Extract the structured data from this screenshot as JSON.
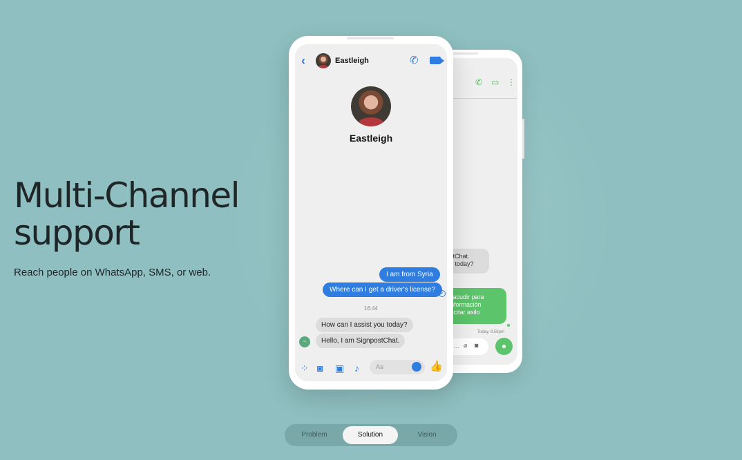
{
  "hero": {
    "title": "Multi-Channel support",
    "subtitle": "Reach people on WhatsApp, SMS, or web."
  },
  "messenger": {
    "contact_name": "Eastleigh",
    "messages_out": [
      "I am from Syria",
      "Where can I get a driver's license?"
    ],
    "time": "16:44",
    "messages_in": [
      "How can I assist you today?",
      "Hello, I am SignpostChat."
    ],
    "input_placeholder": "Aa",
    "bot_badge": "~"
  },
  "whatsapp": {
    "bubble_in_lines": [
      "ostChat.",
      "ou today?"
    ],
    "bubble_out_lines": [
      "do acudir para",
      "s información",
      "solicitar asilo"
    ],
    "timestamp": "Today, 8:58pm",
    "input_dots": "..."
  },
  "tabs": [
    {
      "label": "Problem",
      "active": false
    },
    {
      "label": "Solution",
      "active": true
    },
    {
      "label": "Vision",
      "active": false
    }
  ],
  "colors": {
    "background": "#8fbfc0",
    "messenger_blue": "#2f7de1",
    "whatsapp_green": "#5cc46a"
  }
}
